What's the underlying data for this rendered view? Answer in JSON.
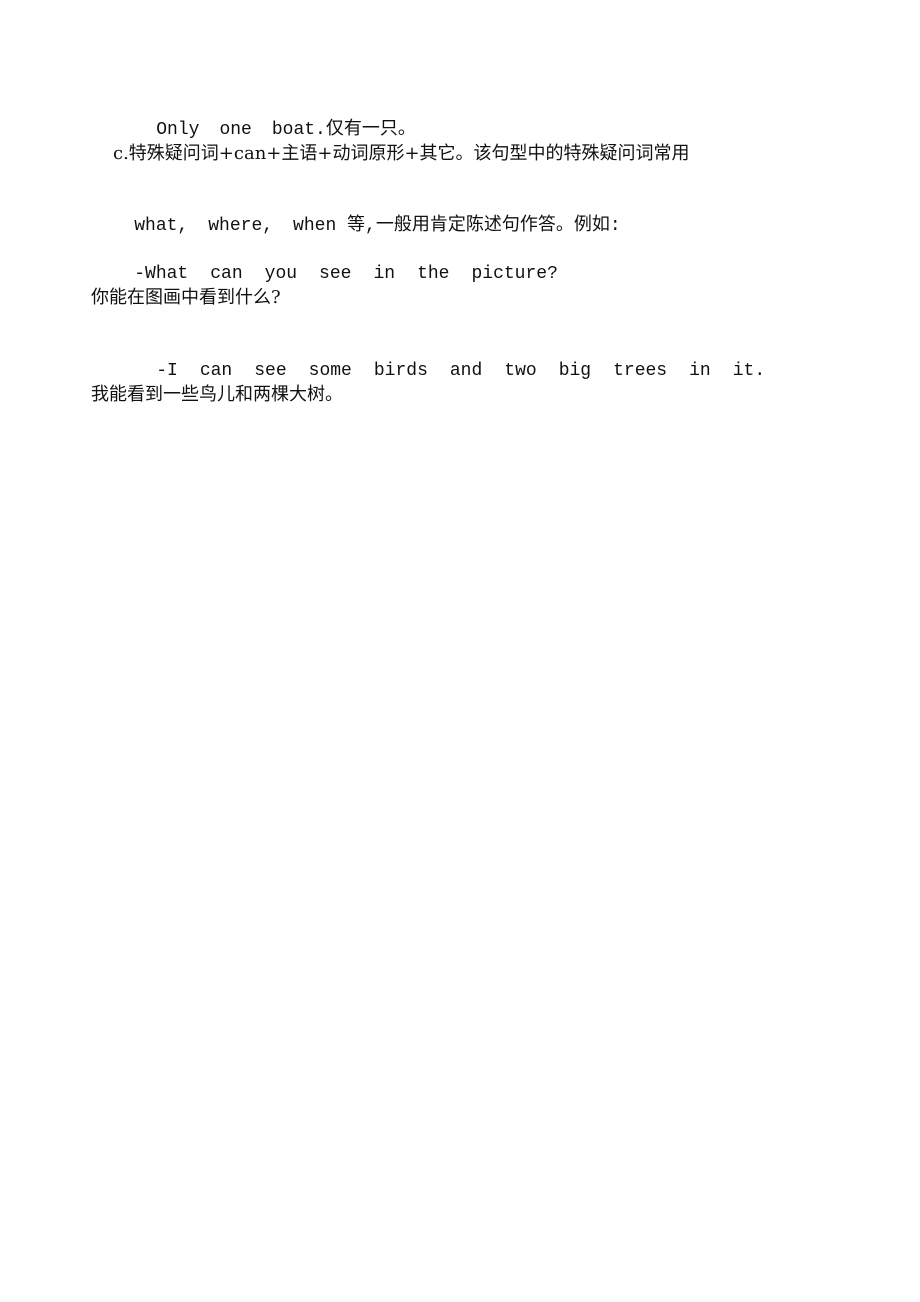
{
  "document": {
    "lines": [
      {
        "segments": [
          "Only",
          "one",
          "boat.仅有一只。"
        ]
      },
      {
        "text": "c.特殊疑问词+can+主语+动词原形+其它。该句型中的特殊疑问词常用"
      },
      {
        "segments": [
          "what,",
          "where,",
          "when 等,一般用肯定陈述句作答。例如:"
        ]
      },
      {
        "segments": [
          "-What",
          "can",
          "you",
          "see",
          "in",
          "the",
          "picture?"
        ]
      },
      {
        "text": "你能在图画中看到什么?"
      },
      {
        "segments": [
          "-I",
          "can",
          "see",
          "some",
          "birds",
          "and",
          "two",
          "big",
          "trees",
          "in",
          "it."
        ]
      },
      {
        "text": "我能看到一些鸟儿和两棵大树。"
      }
    ]
  }
}
